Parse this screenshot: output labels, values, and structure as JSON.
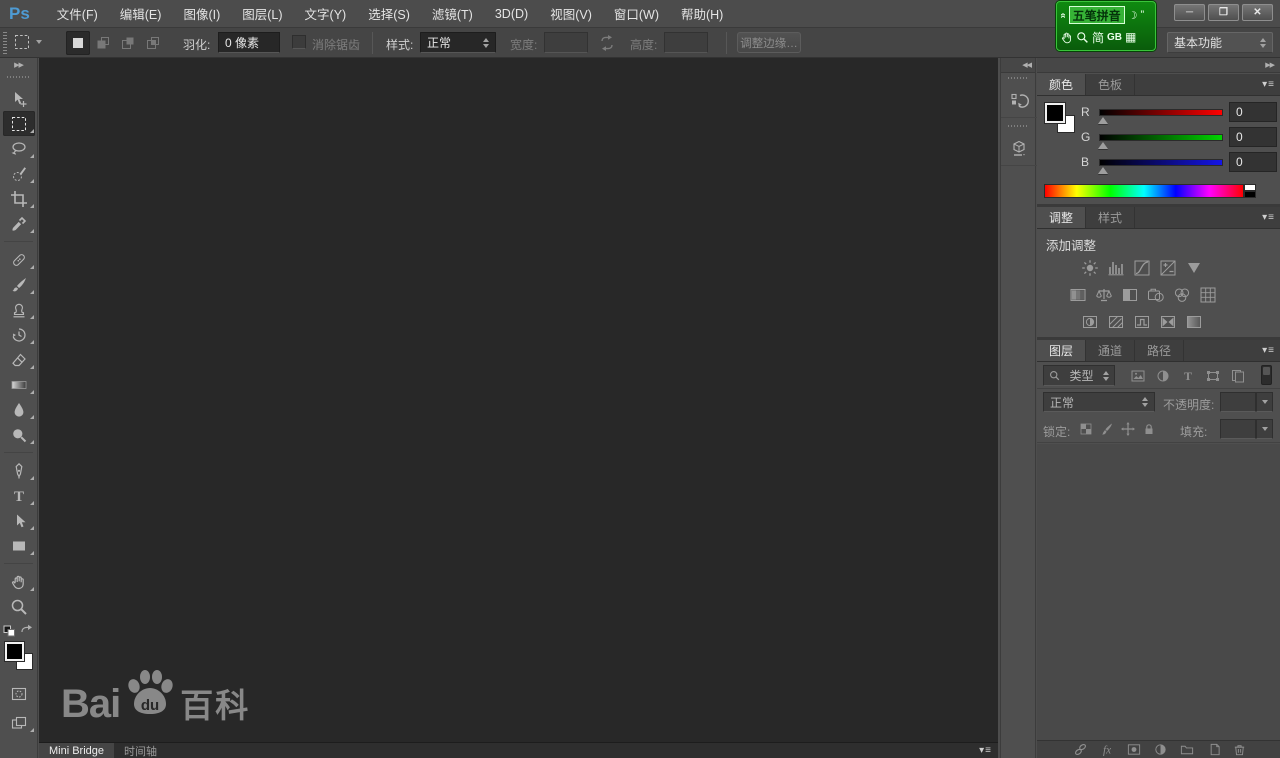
{
  "glyphs": {
    "ps_logo": "Ps",
    "minimize": "─",
    "restore": "❐",
    "close": "✕",
    "toolbar_expand": "▶▶",
    "minidock_collapse": "◀◀",
    "dock_collapse": "▶▶",
    "panel_menu": "▾≡",
    "ime_chevron": "«",
    "ime_moon": "☽",
    "ime_quote": "”",
    "ime_keyboard": "▦"
  },
  "menu": {
    "items": [
      {
        "label": "文件(F)"
      },
      {
        "label": "编辑(E)"
      },
      {
        "label": "图像(I)"
      },
      {
        "label": "图层(L)"
      },
      {
        "label": "文字(Y)"
      },
      {
        "label": "选择(S)"
      },
      {
        "label": "滤镜(T)"
      },
      {
        "label": "3D(D)"
      },
      {
        "label": "视图(V)"
      },
      {
        "label": "窗口(W)"
      },
      {
        "label": "帮助(H)"
      }
    ]
  },
  "ime": {
    "name": "五笔拼音",
    "simplified": "简",
    "gb": "GB"
  },
  "options": {
    "feather_label": "羽化:",
    "feather_value": "0 像素",
    "antialias_label": "消除锯齿",
    "style_label": "样式:",
    "style_value": "正常",
    "width_label": "宽度:",
    "width_value": "",
    "height_label": "高度:",
    "height_value": "",
    "refine_edge": "调整边缘…",
    "workspace": "基本功能"
  },
  "toolbar": {
    "active_tool": "rectangular-marquee",
    "tools": [
      "move",
      "rectangular-marquee",
      "lasso",
      "quick-selection",
      "crop",
      "eyedropper",
      "spot-healing-brush",
      "brush",
      "clone-stamp",
      "history-brush",
      "eraser",
      "gradient",
      "blur",
      "dodge",
      "pen",
      "horizontal-type",
      "path-selection",
      "rectangle",
      "hand",
      "zoom"
    ]
  },
  "canvas": {
    "watermark": {
      "bai": "Bai",
      "du": "du",
      "baike": "百科"
    }
  },
  "bottom": {
    "tabs": [
      {
        "label": "Mini Bridge"
      },
      {
        "label": "时间轴"
      }
    ]
  },
  "panels": {
    "color": {
      "tabs": [
        {
          "label": "颜色"
        },
        {
          "label": "色板"
        }
      ],
      "channels": [
        {
          "label": "R",
          "value": "0"
        },
        {
          "label": "G",
          "value": "0"
        },
        {
          "label": "B",
          "value": "0"
        }
      ]
    },
    "adjustments": {
      "tabs": [
        {
          "label": "调整"
        },
        {
          "label": "样式"
        }
      ],
      "hint": "添加调整",
      "icons_row1": [
        "brightness-contrast",
        "levels",
        "curves",
        "exposure",
        "vibrance"
      ],
      "icons_row2": [
        "hue-saturation",
        "color-balance",
        "black-white",
        "photo-filter",
        "channel-mixer",
        "color-lookup"
      ],
      "icons_row3": [
        "invert",
        "posterize",
        "threshold",
        "gradient-map",
        "selective-color"
      ]
    },
    "layers": {
      "tabs": [
        {
          "label": "图层"
        },
        {
          "label": "通道"
        },
        {
          "label": "路径"
        }
      ],
      "filter_label": "类型",
      "blend_mode": "正常",
      "opacity_label": "不透明度:",
      "lock_label": "锁定:",
      "fill_label": "填充:"
    }
  }
}
